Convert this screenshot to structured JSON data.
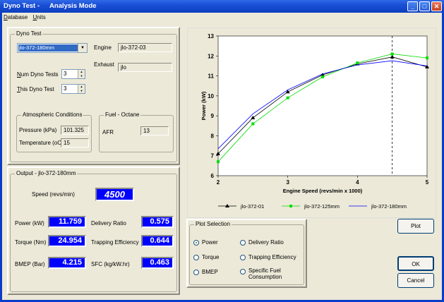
{
  "window": {
    "title_app": "Dyno Test -",
    "title_mode": "Analysis Mode",
    "btn_minimize": "_",
    "btn_maximize": "□",
    "btn_close": "✕"
  },
  "menu": {
    "items": [
      {
        "prefix": "D",
        "rest": "atabase"
      },
      {
        "prefix": "U",
        "rest": "nits"
      }
    ]
  },
  "dyno_test": {
    "group_label": "Dyno Test",
    "selected_test": "jlo-372-180mm",
    "engine_label": "Engine",
    "engine_value": "jlo-372-03",
    "exhaust_label": "Exhaust",
    "exhaust_value": "jlo",
    "num_tests_label_prefix": "N",
    "num_tests_label_rest": "um Dyno Tests",
    "num_tests_value": "3",
    "this_test_label_prefix": "T",
    "this_test_label_rest": "his Dyno Test",
    "this_test_value": "3",
    "atmo_group": "Atmospheric Conditions",
    "pressure_label": "Pressure (kPa)",
    "pressure_value": "101.325",
    "temperature_label": "Temperature (oC)",
    "temperature_value": "15",
    "fuel_group": "Fuel - Octane",
    "afr_label": "AFR",
    "afr_value": "13"
  },
  "output": {
    "group_label": "Output  - jlo-372-180mm",
    "speed_label": "Speed (revs/min)",
    "speed_value": "4500",
    "power_label": "Power (kW)",
    "power_value": "11.759",
    "torque_label": "Torque (Nm)",
    "torque_value": "24.954",
    "bmep_label": "BMEP (Bar)",
    "bmep_value": "4.215",
    "delivery_label": "Delivery Ratio",
    "delivery_value": "0.575",
    "trapping_label": "Trapping Efficiency",
    "trapping_value": "0.644",
    "sfc_label": "SFC (kg/kW.hr)",
    "sfc_value": "0.463"
  },
  "plot_selection": {
    "group_label": "Plot Selection",
    "options": [
      {
        "label": "Power",
        "selected": true
      },
      {
        "label": "Torque",
        "selected": false
      },
      {
        "label": "BMEP",
        "selected": false
      },
      {
        "label": "Delivery Ratio",
        "selected": false
      },
      {
        "label": "Trapping Efficiency",
        "selected": false
      },
      {
        "label": "Specific Fuel Consumption",
        "selected": false
      }
    ]
  },
  "buttons": {
    "plot": "Plot",
    "ok": "OK",
    "cancel": "Cancel"
  },
  "chart_data": {
    "type": "line",
    "xlabel": "Engine Speed  (revs/min x 1000)",
    "ylabel": "Power (kW)",
    "xlim": [
      2,
      5
    ],
    "ylim": [
      6,
      13
    ],
    "x_ticks": [
      2,
      3,
      4,
      5
    ],
    "y_ticks": [
      6,
      7,
      8,
      9,
      10,
      11,
      12,
      13
    ],
    "vertical_marker_x": 4.5,
    "x": [
      2,
      2.5,
      3,
      3.5,
      4,
      4.5,
      5
    ],
    "series": [
      {
        "name": "jlo-372-01",
        "color": "#000000",
        "marker": "triangle",
        "values": [
          7.1,
          8.9,
          10.2,
          11.05,
          11.6,
          11.95,
          11.45
        ]
      },
      {
        "name": "jlo-372-125mm",
        "color": "#00dd00",
        "marker": "square",
        "values": [
          6.7,
          8.6,
          9.9,
          10.95,
          11.65,
          12.1,
          11.9
        ]
      },
      {
        "name": "jlo-372-180mm",
        "color": "#0000ff",
        "marker": "none",
        "values": [
          7.35,
          9.1,
          10.3,
          11.1,
          11.55,
          11.76,
          11.5
        ]
      }
    ]
  }
}
